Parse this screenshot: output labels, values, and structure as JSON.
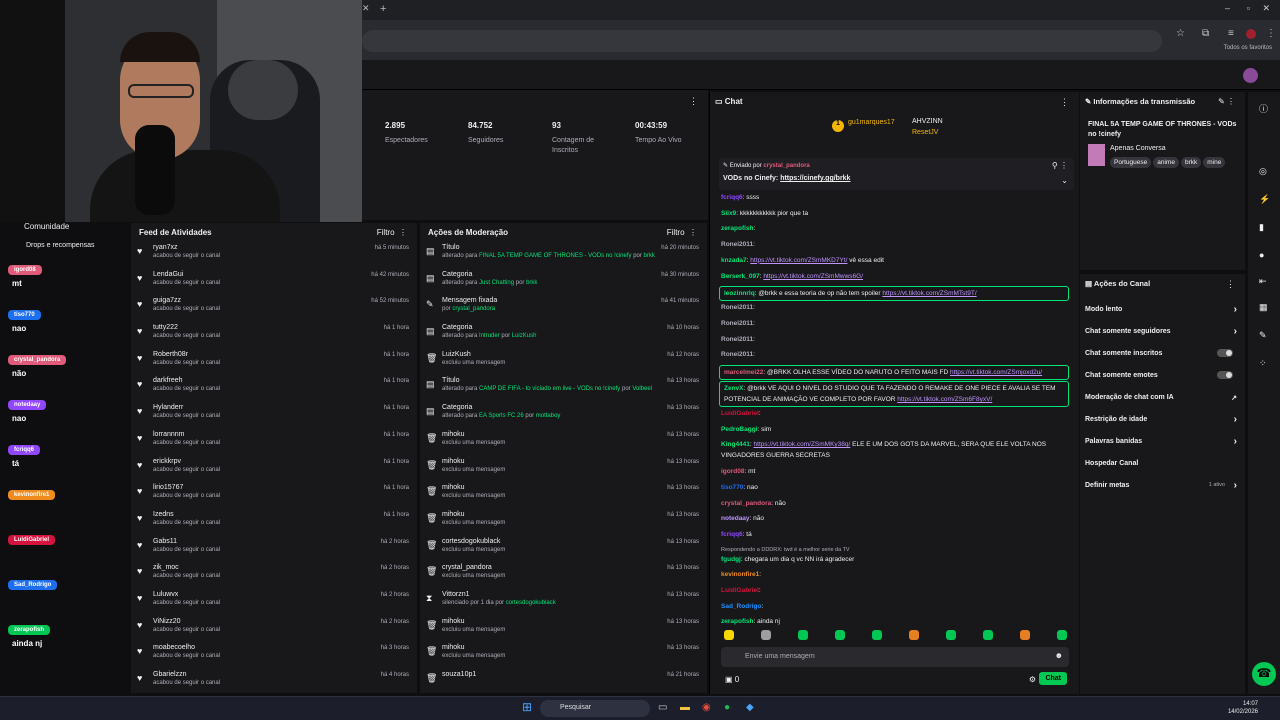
{
  "browser": {
    "favorites_label": "Todos os favoritos"
  },
  "stats": [
    {
      "value": "2.895",
      "label": "Espectadores"
    },
    {
      "value": "84.752",
      "label": "Seguidores"
    },
    {
      "value": "93",
      "label": "Contagem de Inscritos"
    },
    {
      "value": "00:43:59",
      "label": "Tempo Ao Vivo"
    }
  ],
  "left": {
    "community": "Comunidade",
    "drops": "Drops e recompensas",
    "overlay": [
      {
        "name": "igord08",
        "color": "#e05a7a",
        "msg": "mt"
      },
      {
        "name": "tiso770",
        "color": "#1e6ff0",
        "msg": "nao"
      },
      {
        "name": "crystal_pandora",
        "color": "#e05a7a",
        "msg": "não"
      },
      {
        "name": "notedaay",
        "color": "#9146ff",
        "msg": "nao"
      },
      {
        "name": "fcriqq6",
        "color": "#9146ff",
        "msg": "tá"
      },
      {
        "name": "kevinonfire1",
        "color": "#f08c1e",
        "msg": ""
      },
      {
        "name": "LuidiGabriel",
        "color": "#d4143c",
        "msg": ""
      },
      {
        "name": "Sad_Rodrigo",
        "color": "#1e6ff0",
        "msg": ""
      },
      {
        "name": "zerapofish",
        "color": "#00c853",
        "msg": "ainda nj"
      }
    ]
  },
  "feed": {
    "title": "Feed de Atividades",
    "filter": "Filtro",
    "action": "acabou de seguir o canal",
    "items": [
      {
        "u": "ryan7xz",
        "t": "há 5 minutos"
      },
      {
        "u": "LendaGui",
        "t": "há 42 minutos"
      },
      {
        "u": "guiga7zz",
        "t": "há 52 minutos"
      },
      {
        "u": "tutty222",
        "t": "há 1 hora"
      },
      {
        "u": "Roberth08r",
        "t": "há 1 hora"
      },
      {
        "u": "darkfreeh",
        "t": "há 1 hora"
      },
      {
        "u": "Hylanderr",
        "t": "há 1 hora"
      },
      {
        "u": "lorrannnm",
        "t": "há 1 hora"
      },
      {
        "u": "erickkrpv",
        "t": "há 1 hora"
      },
      {
        "u": "lirio15767",
        "t": "há 1 hora"
      },
      {
        "u": "Izedns",
        "t": "há 1 hora"
      },
      {
        "u": "Gabs11",
        "t": "há 2 horas"
      },
      {
        "u": "zik_moc",
        "t": "há 2 horas"
      },
      {
        "u": "Luluwvx",
        "t": "há 2 horas"
      },
      {
        "u": "ViNizz20",
        "t": "há 2 horas"
      },
      {
        "u": "moabecoelho",
        "t": "há 3 horas"
      },
      {
        "u": "Gbarielzzn",
        "t": "há 4 horas"
      }
    ]
  },
  "mod": {
    "title": "Ações de Moderação",
    "filter": "Filtro",
    "items": [
      {
        "icon": "▤",
        "u": "Título",
        "pre": "alterado para",
        "hl": "FINAL 5A TEMP GAME OF THRONES - VODs no !cinefy",
        "post": "por",
        "by": "brkk",
        "t": "há 20 minutos"
      },
      {
        "icon": "▤",
        "u": "Categoria",
        "pre": "alterado para",
        "hl": "Just Chatting",
        "post": "por",
        "by": "brkk",
        "t": "há 30 minutos"
      },
      {
        "icon": "✎",
        "u": "Mensagem fixada",
        "pre": "por",
        "hl": "crystal_pandora",
        "post": "",
        "by": "",
        "t": "há 41 minutos"
      },
      {
        "icon": "▤",
        "u": "Categoria",
        "pre": "alterado para",
        "hl": "Intruder",
        "post": "por",
        "by": "LuizKush",
        "t": "há 10 horas"
      },
      {
        "icon": "🗑",
        "u": "LuizKush",
        "pre": "excluiu uma mensagem",
        "hl": "",
        "post": "",
        "by": "",
        "t": "há 12 horas"
      },
      {
        "icon": "▤",
        "u": "Título",
        "pre": "alterado para",
        "hl": "CAMP DE FIFA - to viciado em live - VODs no !cinefy",
        "post": "por",
        "by": "Volbeel",
        "t": "há 13 horas"
      },
      {
        "icon": "▤",
        "u": "Categoria",
        "pre": "alterado para",
        "hl": "EA Sports FC 26",
        "post": "por",
        "by": "mottaboy",
        "t": "há 13 horas"
      },
      {
        "icon": "🗑",
        "u": "mihoku",
        "pre": "excluiu uma mensagem",
        "hl": "",
        "post": "",
        "by": "",
        "t": "há 13 horas"
      },
      {
        "icon": "🗑",
        "u": "mihoku",
        "pre": "excluiu uma mensagem",
        "hl": "",
        "post": "",
        "by": "",
        "t": "há 13 horas"
      },
      {
        "icon": "🗑",
        "u": "mihoku",
        "pre": "excluiu uma mensagem",
        "hl": "",
        "post": "",
        "by": "",
        "t": "há 13 horas"
      },
      {
        "icon": "🗑",
        "u": "mihoku",
        "pre": "excluiu uma mensagem",
        "hl": "",
        "post": "",
        "by": "",
        "t": "há 13 horas"
      },
      {
        "icon": "🗑",
        "u": "cortesdogokublack",
        "pre": "excluiu uma mensagem",
        "hl": "",
        "post": "",
        "by": "",
        "t": "há 13 horas"
      },
      {
        "icon": "🗑",
        "u": "crystal_pandora",
        "pre": "excluiu uma mensagem",
        "hl": "",
        "post": "",
        "by": "",
        "t": "há 13 horas"
      },
      {
        "icon": "⧗",
        "u": "Vittorzn1",
        "pre": "silenciado por 1 dia por",
        "hl": "cortesdogokublack",
        "post": "",
        "by": "",
        "t": "há 13 horas"
      },
      {
        "icon": "🗑",
        "u": "mihoku",
        "pre": "excluiu uma mensagem",
        "hl": "",
        "post": "",
        "by": "",
        "t": "há 13 horas"
      },
      {
        "icon": "🗑",
        "u": "mihoku",
        "pre": "excluiu uma mensagem",
        "hl": "",
        "post": "",
        "by": "",
        "t": "há 13 horas"
      },
      {
        "icon": "🗑",
        "u": "souza10p1",
        "pre": "",
        "hl": "",
        "post": "",
        "by": "",
        "t": "há 21 horas"
      }
    ]
  },
  "chat": {
    "title": "Chat",
    "leaders": [
      {
        "name": "gu1marques17",
        "n": "1"
      },
      {
        "name": "AHVZINN",
        "n": "1"
      },
      {
        "name": "ResetJV",
        "n": "1"
      }
    ],
    "pinned_by": "Enviado por",
    "pinned_user": "crystal_pandora",
    "pinned_text": "VODs no Cinefy:",
    "pinned_link": "https://cinefy.gg/brkk",
    "messages": [
      {
        "u": "fcriqq6",
        "c": "#9146ff",
        "t": "ssss"
      },
      {
        "u": "Siix9",
        "c": "#00e676",
        "t": "kkkkkkkkkkk pior que ta"
      },
      {
        "u": "zerapofish",
        "c": "#00e676",
        "t": ""
      },
      {
        "u": "Ronei2011",
        "c": "#adadb8",
        "t": ""
      },
      {
        "u": "knzada7",
        "c": "#00e676",
        "t": "",
        "l": "https://vt.tiktok.com/ZSmMKD7Yt/",
        "a": "vê essa edit"
      },
      {
        "u": "Berserk_097",
        "c": "#00e676",
        "t": "",
        "l": "https://vt.tiktok.com/ZSmMwws6G/"
      },
      {
        "u": "leozinnrlq",
        "c": "#00e676",
        "t": "@brkk e essa teoria de op não tem spoiler",
        "l": "https://vt.tiktok.com/ZSmMTst9T/",
        "hl": true
      },
      {
        "u": "Ronei2011",
        "c": "#adadb8",
        "t": ""
      },
      {
        "u": "Ronei2011",
        "c": "#adadb8",
        "t": ""
      },
      {
        "u": "Ronei2011",
        "c": "#adadb8",
        "t": ""
      },
      {
        "u": "Ronei2011",
        "c": "#adadb8",
        "t": ""
      },
      {
        "u": "marcelmei22",
        "c": "#e05a7a",
        "t": "@BRKK OLHA ESSE VÍDEO DO NARUTO O FEITO MAIS FD",
        "l": "https://vt.tiktok.com/ZSmjoxd2u/",
        "hl": true
      },
      {
        "u": "ZenvX",
        "c": "#00e676",
        "t": "@brkk VE AQUI O NIVEL DO STUDIO QUE TA FAZENDO O REMAKE DE ONE PIECE E AVALIA SE TEM POTENCIAL DE ANIMAÇÃO VE COMPLETO POR FAVOR",
        "l": "https://vt.tiktok.com/ZSm6F8yxV/",
        "hl": true,
        "two": true
      },
      {
        "u": "LuidiGabriel",
        "c": "#d4143c",
        "t": ""
      },
      {
        "u": "PedroBaggi",
        "c": "#00e676",
        "t": "sim"
      },
      {
        "u": "King4441",
        "c": "#00e676",
        "t": "",
        "l": "https://vt.tiktok.com/ZSmMKy38q/",
        "a": "ELE E UM DOS GOTS DA MARVEL, SERA QUE ELE VOLTA NOS VINGADORES GUERRA SECRETAS",
        "two": true
      },
      {
        "u": "igord08",
        "c": "#e05a7a",
        "t": "mt"
      },
      {
        "u": "tiso770",
        "c": "#1e6ff0",
        "t": "nao"
      },
      {
        "u": "crystal_pandora",
        "c": "#e05a7a",
        "t": "não"
      },
      {
        "u": "notedaay",
        "c": "#bf94ff",
        "t": "não"
      },
      {
        "u": "fcriqq6",
        "c": "#9146ff",
        "t": "tá"
      },
      {
        "u": "fgudgj",
        "c": "#00e676",
        "t": "chegara um dia q vc NN irá agradecer",
        "reply": "Respondendo a DDDRX: twd é a melhor serie da TV"
      },
      {
        "u": "kevinonfire1",
        "c": "#f08c1e",
        "t": ""
      },
      {
        "u": "LuidiGabriel",
        "c": "#d4143c",
        "t": ""
      },
      {
        "u": "Sad_Rodrigo",
        "c": "#1e90ff",
        "t": ""
      },
      {
        "u": "zerapofish",
        "c": "#00e676",
        "t": "ainda nj"
      }
    ],
    "input_placeholder": "Envie uma mensagem",
    "points": "0",
    "send": "Chat"
  },
  "info": {
    "title": "Informações da transmissão",
    "stream_title": "FINAL 5A TEMP GAME OF THRONES - VODs no !cinefy",
    "category": "Apenas Conversa",
    "tags": [
      "Portuguese",
      "anime",
      "brkk",
      "mine"
    ]
  },
  "actions": {
    "title": "Ações do Canal",
    "items": [
      {
        "label": "Modo lento",
        "kind": "chevron"
      },
      {
        "label": "Chat somente seguidores",
        "kind": "chevron"
      },
      {
        "label": "Chat somente inscritos",
        "kind": "toggle"
      },
      {
        "label": "Chat somente emotes",
        "kind": "toggle"
      },
      {
        "label": "Moderação de chat com IA",
        "kind": "ext"
      },
      {
        "label": "Restrição de idade",
        "kind": "chevron"
      },
      {
        "label": "Palavras banidas",
        "kind": "chevron"
      },
      {
        "label": "Hospedar Canal",
        "kind": "none"
      },
      {
        "label": "Definir metas",
        "kind": "chevron",
        "badge": "1 ativo"
      }
    ]
  },
  "taskbar": {
    "search": "Pesquisar",
    "time": "14:07",
    "date": "14/02/2026"
  }
}
